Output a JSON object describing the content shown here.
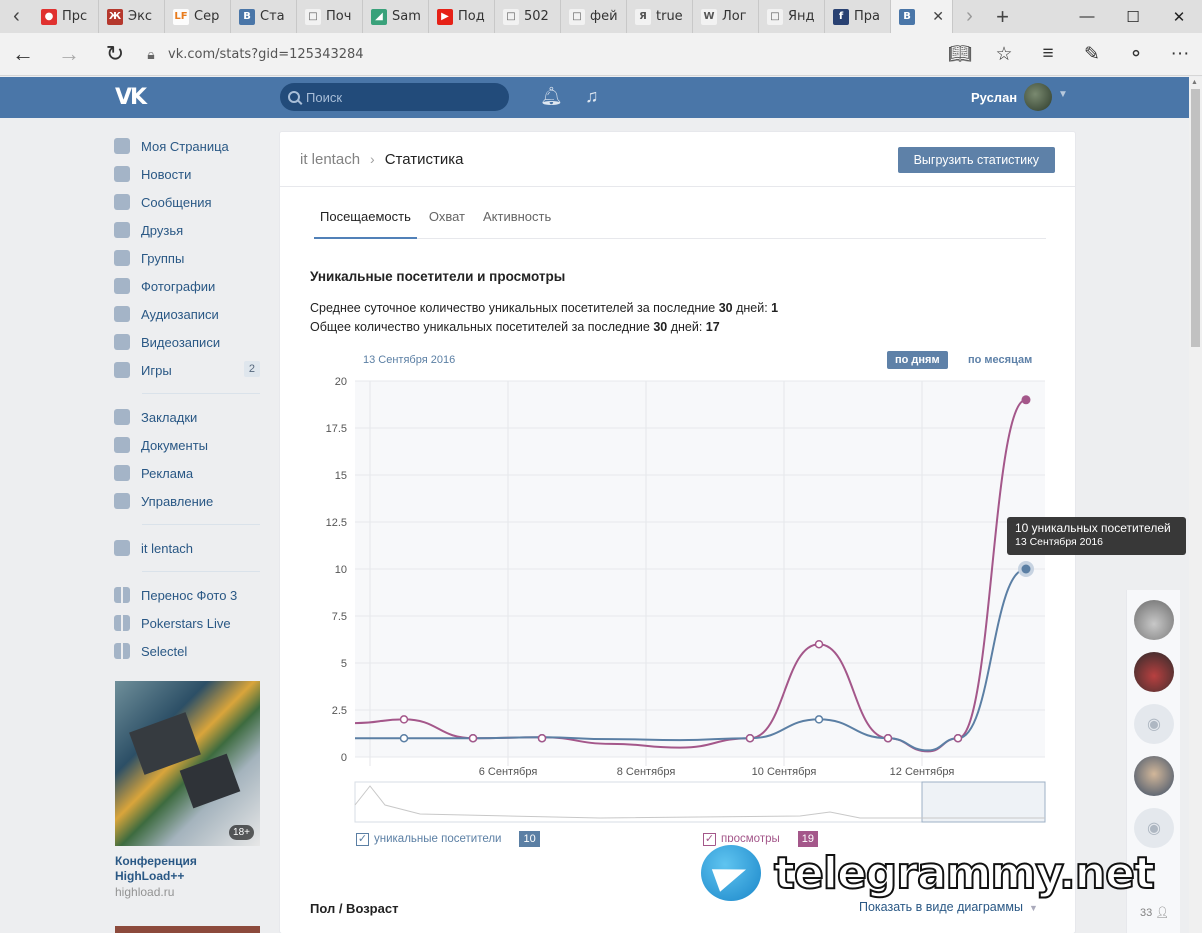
{
  "browser": {
    "tabs": [
      {
        "label": "Прс",
        "fav_color": "#e0312f",
        "fav": "●"
      },
      {
        "label": "Экс",
        "fav_color": "#b5382d",
        "fav": "Ж"
      },
      {
        "label": "Сер",
        "fav_color": "#fcfcfc",
        "fav": "LF"
      },
      {
        "label": "Ста",
        "fav_color": "#4a76a8",
        "fav": "B"
      },
      {
        "label": "Поч",
        "fav_color": "#f2f2f2",
        "fav": "□"
      },
      {
        "label": "Sam",
        "fav_color": "#39a17a",
        "fav": "◢"
      },
      {
        "label": "Под",
        "fav_color": "#e62117",
        "fav": "▶"
      },
      {
        "label": "502",
        "fav_color": "#f2f2f2",
        "fav": "□"
      },
      {
        "label": "фей",
        "fav_color": "#f2f2f2",
        "fav": "□"
      },
      {
        "label": "true",
        "fav_color": "#f2f2f2",
        "fav": "Я"
      },
      {
        "label": "Лог",
        "fav_color": "#f2f2f2",
        "fav": "W"
      },
      {
        "label": "Янд",
        "fav_color": "#f2f2f2",
        "fav": "□"
      },
      {
        "label": "Пра",
        "fav_color": "#294172",
        "fav": "f"
      }
    ],
    "active_tab_fav": "B",
    "url": "vk.com/stats?gid=125343284"
  },
  "header": {
    "logo": "VK",
    "search_placeholder": "Поиск",
    "username": "Руслан"
  },
  "menu": {
    "main": [
      {
        "label": "Моя Страница",
        "icon": "home-icon"
      },
      {
        "label": "Новости",
        "icon": "news-icon"
      },
      {
        "label": "Сообщения",
        "icon": "messages-icon"
      },
      {
        "label": "Друзья",
        "icon": "friends-icon"
      },
      {
        "label": "Группы",
        "icon": "groups-icon"
      },
      {
        "label": "Фотографии",
        "icon": "camera-icon"
      },
      {
        "label": "Аудиозаписи",
        "icon": "music-icon"
      },
      {
        "label": "Видеозаписи",
        "icon": "video-icon"
      },
      {
        "label": "Игры",
        "icon": "gamepad-icon",
        "badge": "2"
      }
    ],
    "secondary": [
      {
        "label": "Закладки",
        "icon": "star-icon"
      },
      {
        "label": "Документы",
        "icon": "document-icon"
      },
      {
        "label": "Реклама",
        "icon": "megaphone-icon"
      },
      {
        "label": "Управление",
        "icon": "gamepad-icon"
      }
    ],
    "groups": [
      {
        "label": "it lentach",
        "icon": "group-icon"
      }
    ],
    "apps": [
      {
        "label": "Перенос Фото 3",
        "icon": "app-icon"
      },
      {
        "label": "Pokerstars Live",
        "icon": "app-icon"
      },
      {
        "label": "Selectel",
        "icon": "app-icon"
      }
    ]
  },
  "ad": {
    "age": "18+",
    "title": "Конференция HighLoad++",
    "domain": "highload.ru"
  },
  "page": {
    "crumb_group": "it lentach",
    "crumb_page": "Статистика",
    "export_button": "Выгрузить статистику",
    "tabs": [
      "Посещаемость",
      "Охват",
      "Активность"
    ],
    "section_title": "Уникальные посетители и просмотры",
    "line1_prefix": "Среднее суточное количество уникальных посетителей за последние ",
    "line1_days": "30",
    "line1_mid": " дней: ",
    "line1_value": "1",
    "line2_prefix": "Общее количество уникальных посетителей за последние ",
    "line2_days": "30",
    "line2_mid": " дней: ",
    "line2_value": "17",
    "period_by_day": "по дням",
    "period_by_month": "по месяцам",
    "age_section": "Пол / Возраст",
    "age_view_link": "Показать в виде диаграммы"
  },
  "chart_data": {
    "type": "line",
    "title": "",
    "date_label": "13 Сентября 2016",
    "x": [
      "3 Сентября",
      "4 Сентября",
      "5 Сентября",
      "6 Сентября",
      "7 Сентября",
      "8 Сентября",
      "9 Сентября",
      "10 Сентября",
      "11 Сентября",
      "12 Сентября",
      "13 Сентября"
    ],
    "x_tick_labels": [
      "6 Сентября",
      "8 Сентября",
      "10 Сентября",
      "12 Сентября"
    ],
    "ylim": [
      0,
      20
    ],
    "y_ticks": [
      "0",
      "2.5",
      "5",
      "7.5",
      "10",
      "12.5",
      "15",
      "17.5",
      "20"
    ],
    "grid": true,
    "series": [
      {
        "name": "уникальные посетители",
        "color": "#5b7fa4",
        "values": [
          1,
          1,
          1,
          1,
          1,
          1,
          1,
          1,
          2,
          1,
          1,
          10
        ],
        "current": "10"
      },
      {
        "name": "просмотры",
        "color": "#a4578a",
        "values": [
          1.8,
          2,
          1,
          1,
          1,
          1,
          1,
          1,
          6,
          1,
          1,
          19
        ],
        "current": "19"
      }
    ],
    "tooltip": {
      "title": "10 уникальных посетителей",
      "date": "13 Сентября 2016"
    }
  },
  "rightbar": {
    "count": "33"
  },
  "watermark": "telegrammy.net"
}
